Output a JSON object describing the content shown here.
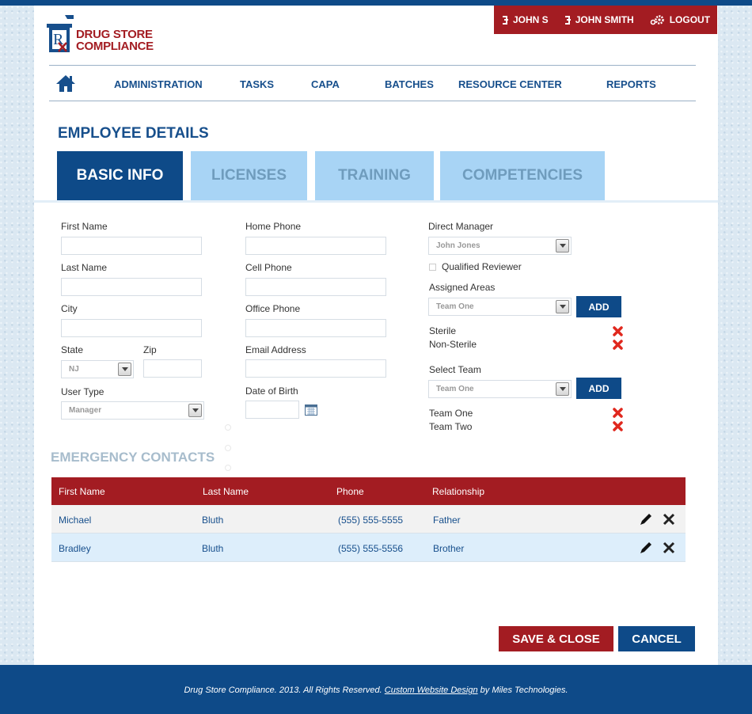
{
  "brand": {
    "line1": "DRUG STORE",
    "line2": "COMPLIANCE",
    "mark": "R"
  },
  "userbar": {
    "user_short": "JOHN S",
    "user_full": "JOHN SMITH",
    "logout": "LOGOUT"
  },
  "nav": [
    "ADMINISTRATION",
    "TASKS",
    "CAPA",
    "BATCHES",
    "RESOURCE CENTER",
    "REPORTS"
  ],
  "page_title": "EMPLOYEE DETAILS",
  "tabs": [
    "BASIC INFO",
    "LICENSES",
    "TRAINING",
    "COMPETENCIES"
  ],
  "form": {
    "first_name": "First Name",
    "last_name": "Last Name",
    "city": "City",
    "state": "State",
    "state_value": "NJ",
    "zip": "Zip",
    "user_type": "User Type",
    "user_type_value": "Manager",
    "home_phone": "Home Phone",
    "cell_phone": "Cell Phone",
    "office_phone": "Office Phone",
    "email": "Email Address",
    "dob": "Date of Birth",
    "direct_manager": "Direct Manager",
    "direct_manager_value": "John Jones",
    "qualified_reviewer": "Qualified Reviewer",
    "assigned_areas": "Assigned Areas",
    "assigned_areas_value": "Team One",
    "areas_list": [
      "Sterile",
      "Non-Sterile"
    ],
    "select_team": "Select Team",
    "select_team_value": "Team One",
    "team_list": [
      "Team One",
      "Team Two"
    ],
    "add_label": "ADD"
  },
  "emergency": {
    "title": "EMERGENCY CONTACTS",
    "headers": [
      "First Name",
      "Last Name",
      "Phone",
      "Relationship"
    ],
    "rows": [
      [
        "Michael",
        "Bluth",
        "(555) 555-5555",
        "Father"
      ],
      [
        "Bradley",
        "Bluth",
        "(555) 555-5556",
        "Brother"
      ]
    ]
  },
  "buttons": {
    "save": "SAVE & CLOSE",
    "cancel": "CANCEL"
  },
  "footer": {
    "text": "Drug Store Compliance. 2013. All Rights Reserved.",
    "link": "Custom Website Design",
    "suffix": "by Miles Technologies."
  },
  "colors": {
    "brand_blue": "#0e4a88",
    "brand_red": "#a31c22",
    "tab_inactive": "#a8d4f5"
  },
  "icons": [
    "home-icon",
    "user-icon",
    "gear-icon",
    "calendar-icon",
    "remove-icon",
    "edit-icon",
    "delete-icon",
    "dropdown-arrow-icon"
  ]
}
